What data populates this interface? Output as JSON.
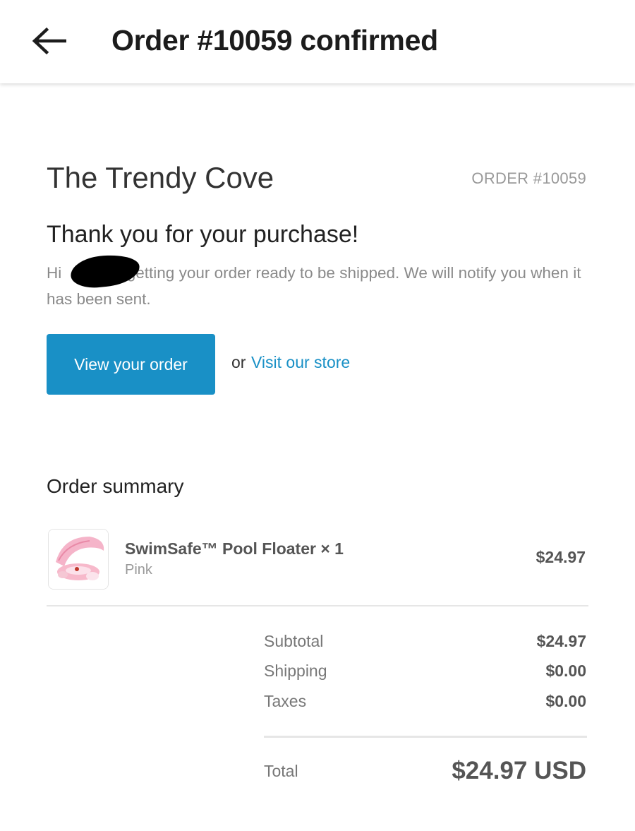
{
  "appbar": {
    "back_icon": "arrow-left-icon",
    "title": "Order #10059 confirmed"
  },
  "email": {
    "shop_name": "The Trendy Cove",
    "order_number": "ORDER #10059",
    "heading": "Thank you for your purchase!",
    "greeting_start": "Hi ",
    "greeting_rest": "re getting your order ready to be shipped. We will notify you when it has been sent.",
    "view_order_label": "View your order",
    "or_text": "or",
    "visit_store_label": "Visit our store",
    "accent_color": "#1990c6"
  },
  "summary": {
    "title": "Order summary",
    "items": [
      {
        "title": "SwimSafe™ Pool Floater × 1",
        "variant": "Pink",
        "price": "$24.97",
        "thumbnail_icon": "pink-pool-float-image"
      }
    ],
    "lines": [
      {
        "label": "Subtotal",
        "value": "$24.97"
      },
      {
        "label": "Shipping",
        "value": "$0.00"
      },
      {
        "label": "Taxes",
        "value": "$0.00"
      }
    ],
    "total_label": "Total",
    "total_value": "$24.97 USD"
  }
}
